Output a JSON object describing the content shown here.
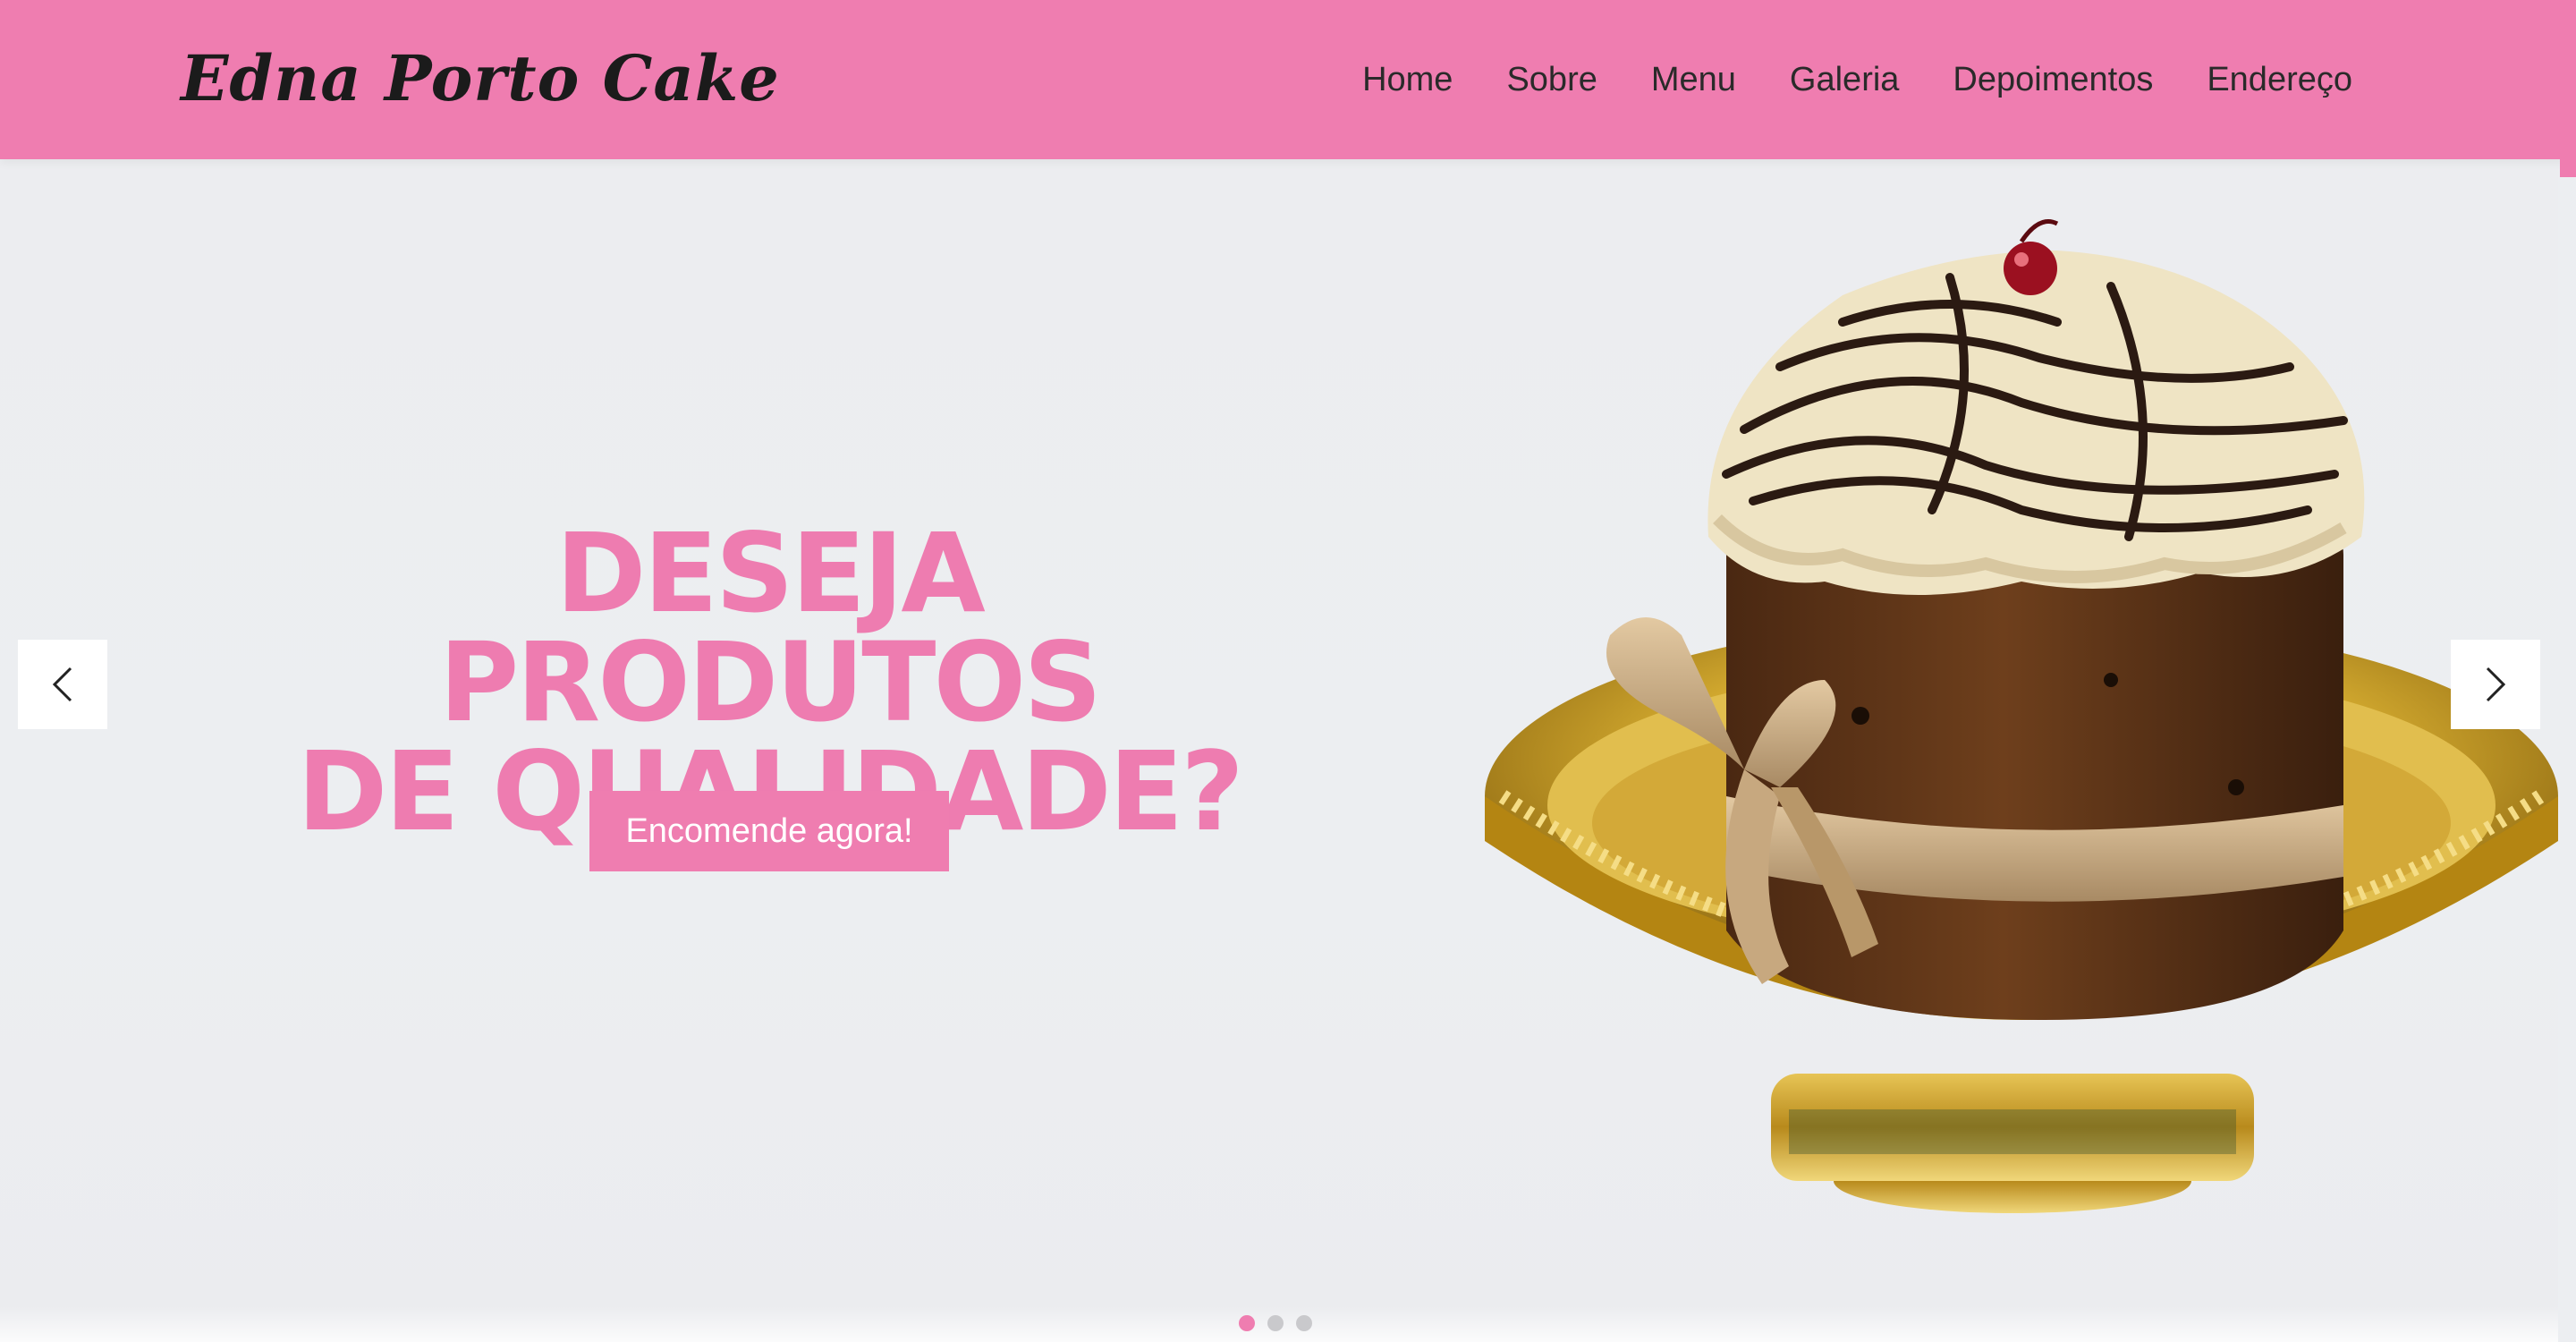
{
  "header": {
    "logo": "Edna Porto Cake",
    "nav": [
      "Home",
      "Sobre",
      "Menu",
      "Galeria",
      "Depoimentos",
      "Endereço"
    ],
    "background_color": "#ef7db0"
  },
  "hero": {
    "headline_line1": "DESEJA PRODUTOS",
    "headline_line2": "DE QUALIDADE?",
    "cta_label": "Encomende agora!",
    "accent_color": "#ee7cb0",
    "prev_icon": "chevron-left-icon",
    "next_icon": "chevron-right-icon",
    "slide_count": 3,
    "active_slide": 1
  }
}
